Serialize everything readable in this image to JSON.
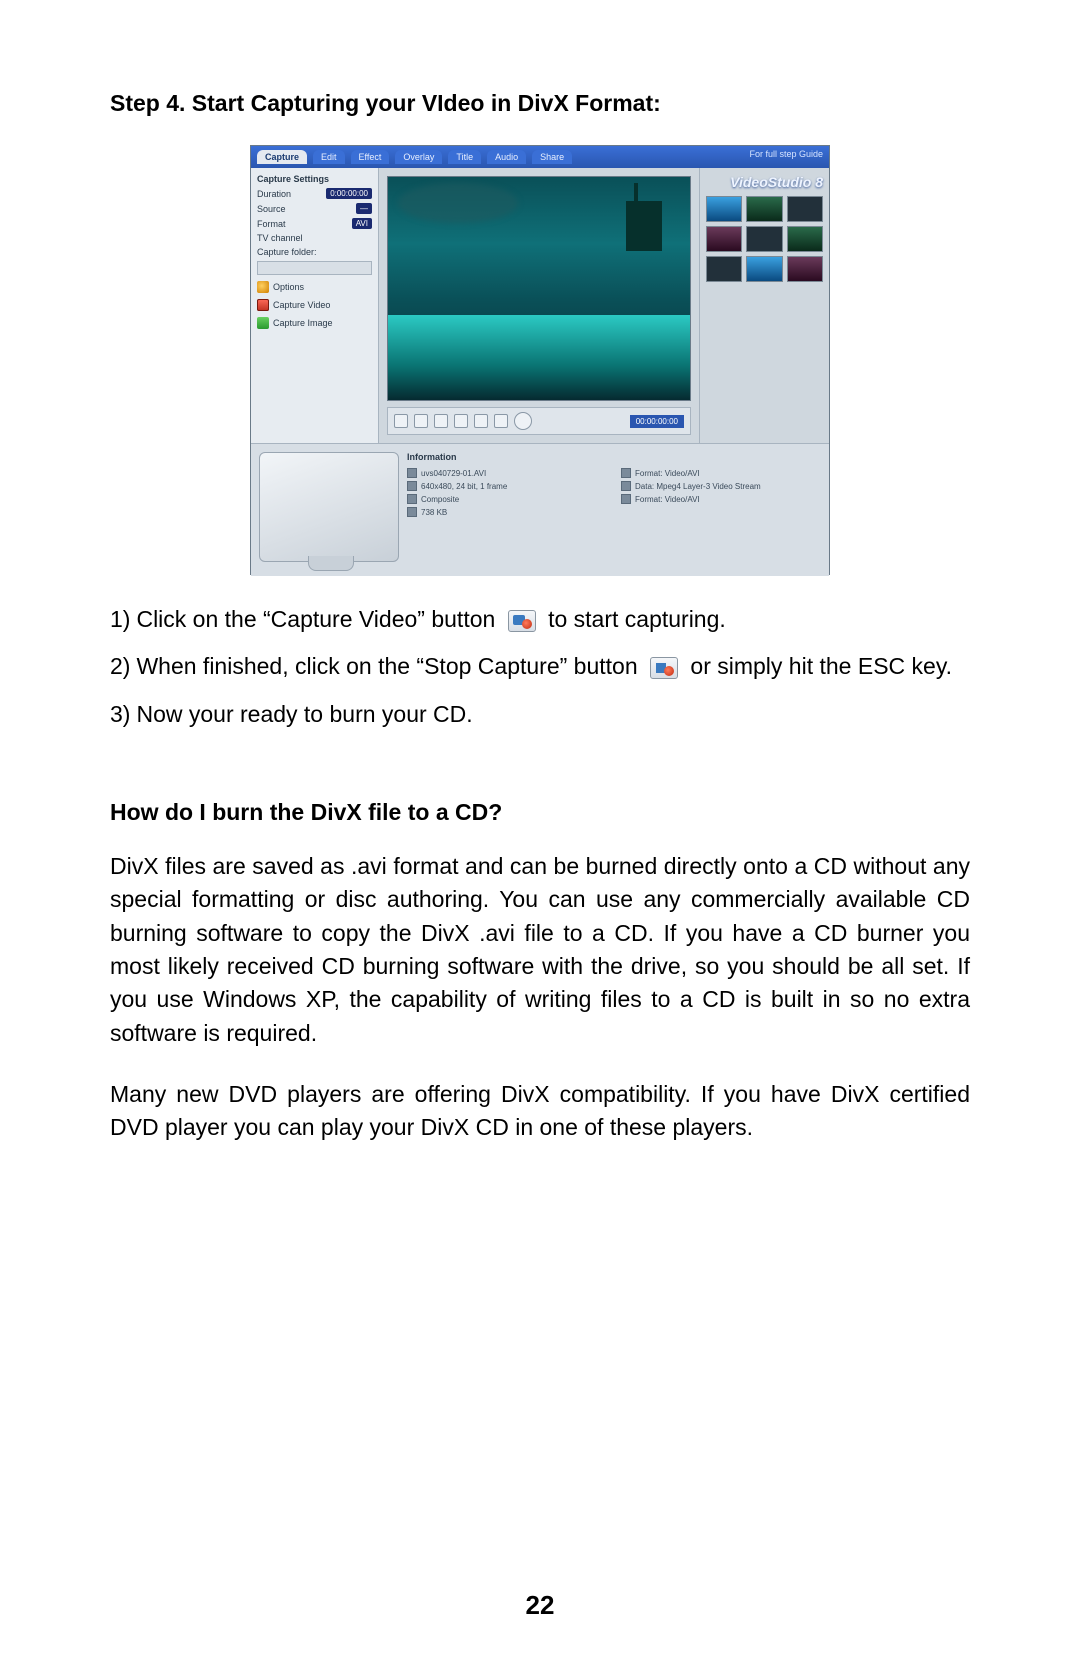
{
  "heading": "Step 4. Start Capturing your VIdeo in DivX Format:",
  "screenshot": {
    "app_name": "VideoStudio 8",
    "guide_text": "For full step Guide",
    "tabs": [
      "Capture",
      "Edit",
      "Effect",
      "Overlay",
      "Title",
      "Audio",
      "Share"
    ],
    "left_panel": {
      "title": "Capture Settings",
      "rows": [
        {
          "label": "Duration",
          "value": "0:00:00:00"
        },
        {
          "label": "Source",
          "value": "—"
        },
        {
          "label": "Format",
          "value": "AVI"
        },
        {
          "label": "TV channel",
          "value": ""
        }
      ],
      "folder_label": "Capture folder:",
      "links": [
        "Options",
        "Capture Video",
        "Capture Image"
      ]
    },
    "controls_time": "00:00:00:00",
    "info_title": "Information",
    "info_rows_left": [
      "uvs040729-01.AVI",
      "640x480, 24 bit, 1 frame",
      "Composite",
      "738 KB"
    ],
    "info_rows_right": [
      "Format: Video/AVI",
      "Data: Mpeg4 Layer-3 Video Stream",
      "Format: Video/AVI"
    ]
  },
  "steps": [
    {
      "num": "1)",
      "before": "Click on the “Capture Video” button",
      "after": "to start capturing.",
      "icon": "cap"
    },
    {
      "num": "2)",
      "before": "When finished, click on the “Stop Capture” button",
      "after": "or simply hit the ESC key.",
      "icon": "stop"
    },
    {
      "num": "3)",
      "before": "Now your ready to burn your CD.",
      "after": "",
      "icon": ""
    }
  ],
  "subheading": "How do I burn the DivX file to a CD?",
  "para1": "DivX files are saved as .avi format and can be burned directly onto a CD without any special formatting or disc authoring. You can use any commercially available CD burning software to copy the DivX .avi file to a CD. If you have a CD burner you most likely received CD burning software with the drive, so you should be all set. If you use Windows XP, the capability of writing files to a CD is built in so no extra software is required.",
  "para2": "Many new DVD players are offering DivX compatibility. If you have DivX certified DVD player you can play your DivX CD in one of these players.",
  "page_number": "22"
}
